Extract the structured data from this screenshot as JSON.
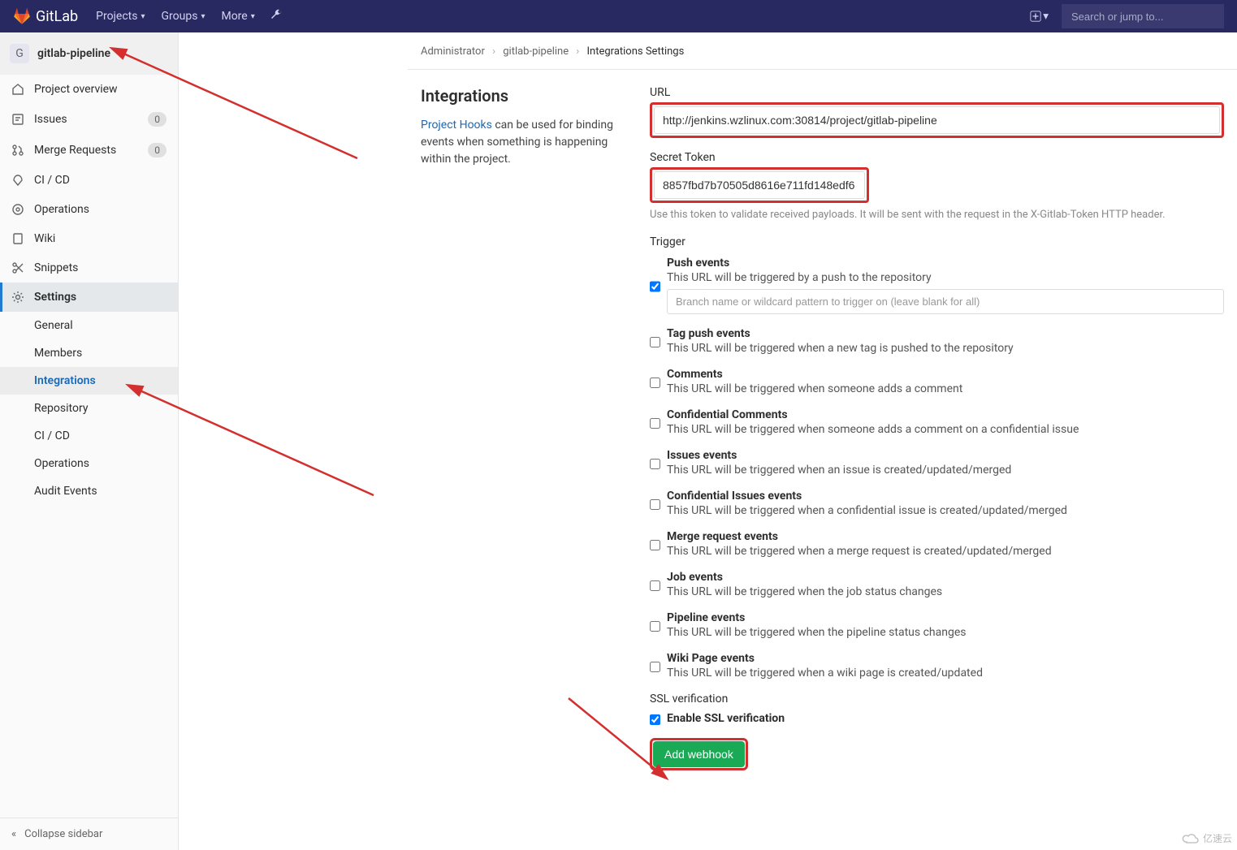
{
  "topnav": {
    "brand": "GitLab",
    "projects": "Projects",
    "groups": "Groups",
    "more": "More",
    "search_placeholder": "Search or jump to..."
  },
  "project": {
    "avatar_letter": "G",
    "name": "gitlab-pipeline"
  },
  "sidebar": {
    "overview": "Project overview",
    "issues": "Issues",
    "issues_count": "0",
    "mrs": "Merge Requests",
    "mrs_count": "0",
    "cicd": "CI / CD",
    "ops": "Operations",
    "wiki": "Wiki",
    "snippets": "Snippets",
    "settings": "Settings",
    "sub": {
      "general": "General",
      "members": "Members",
      "integrations": "Integrations",
      "repository": "Repository",
      "cicd": "CI / CD",
      "operations": "Operations",
      "audit": "Audit Events"
    },
    "collapse": "Collapse sidebar"
  },
  "breadcrumb": {
    "admin": "Administrator",
    "proj": "gitlab-pipeline",
    "page": "Integrations Settings"
  },
  "intro": {
    "title": "Integrations",
    "link": "Project Hooks",
    "text": " can be used for binding events when something is happening within the project."
  },
  "form": {
    "url_label": "URL",
    "url_value": "http://jenkins.wzlinux.com:30814/project/gitlab-pipeline",
    "token_label": "Secret Token",
    "token_value": "8857fbd7b70505d8616e711fd148edf6",
    "token_help": "Use this token to validate received payloads. It will be sent with the request in the X-Gitlab-Token HTTP header.",
    "trigger_section": "Trigger",
    "push": "Push events",
    "push_d": "This URL will be triggered by a push to the repository",
    "push_branch_ph": "Branch name or wildcard pattern to trigger on (leave blank for all)",
    "tag": "Tag push events",
    "tag_d": "This URL will be triggered when a new tag is pushed to the repository",
    "comments": "Comments",
    "comments_d": "This URL will be triggered when someone adds a comment",
    "ccomments": "Confidential Comments",
    "ccomments_d": "This URL will be triggered when someone adds a comment on a confidential issue",
    "issues": "Issues events",
    "issues_d": "This URL will be triggered when an issue is created/updated/merged",
    "cissues": "Confidential Issues events",
    "cissues_d": "This URL will be triggered when a confidential issue is created/updated/merged",
    "mr": "Merge request events",
    "mr_d": "This URL will be triggered when a merge request is created/updated/merged",
    "job": "Job events",
    "job_d": "This URL will be triggered when the job status changes",
    "pipeline": "Pipeline events",
    "pipeline_d": "This URL will be triggered when the pipeline status changes",
    "wiki": "Wiki Page events",
    "wiki_d": "This URL will be triggered when a wiki page is created/updated",
    "ssl_section": "SSL verification",
    "ssl": "Enable SSL verification",
    "submit": "Add webhook"
  },
  "watermark": "亿速云"
}
